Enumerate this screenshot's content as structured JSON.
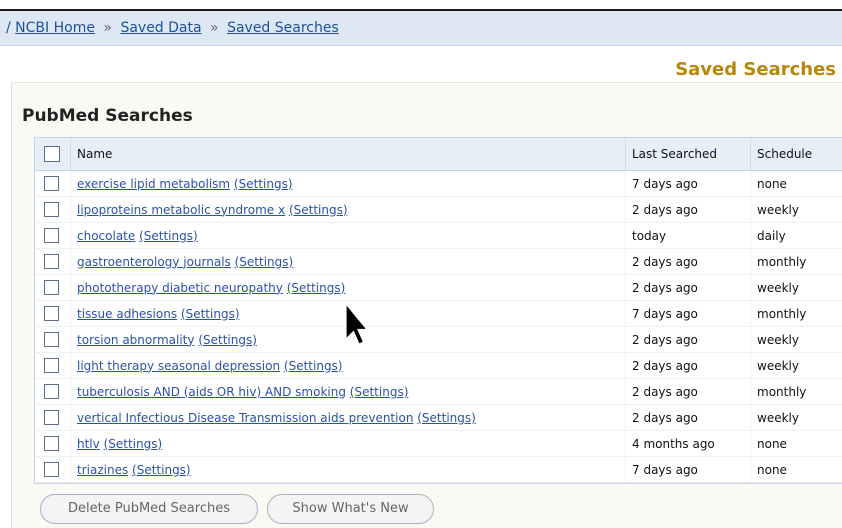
{
  "breadcrumb": {
    "lead": "/",
    "items": [
      "NCBI Home",
      "Saved Data",
      "Saved Searches"
    ],
    "separator": "»"
  },
  "page_heading": "Saved Searches",
  "section_title": "PubMed Searches",
  "table": {
    "columns": {
      "name": "Name",
      "last_searched": "Last Searched",
      "schedule": "Schedule"
    },
    "settings_label": "(Settings)",
    "rows": [
      {
        "name": "exercise lipid metabolism",
        "last": "7 days ago",
        "schedule": "none"
      },
      {
        "name": "lipoproteins metabolic syndrome x",
        "last": "2 days ago",
        "schedule": "weekly"
      },
      {
        "name": "chocolate",
        "last": "today",
        "schedule": "daily"
      },
      {
        "name": "gastroenterology journals",
        "last": "2 days ago",
        "schedule": "monthly"
      },
      {
        "name": "phototherapy diabetic neuropathy",
        "last": "2 days ago",
        "schedule": "weekly"
      },
      {
        "name": "tissue adhesions",
        "last": "7 days ago",
        "schedule": "monthly"
      },
      {
        "name": "torsion abnormality",
        "last": "2 days ago",
        "schedule": "weekly"
      },
      {
        "name": "light therapy seasonal depression",
        "last": "2 days ago",
        "schedule": "weekly"
      },
      {
        "name": "tuberculosis AND (aids OR hiv) AND smoking",
        "last": "2 days ago",
        "schedule": "monthly"
      },
      {
        "name": "vertical Infectious Disease Transmission aids prevention",
        "last": "2 days ago",
        "schedule": "weekly"
      },
      {
        "name": "htlv",
        "last": "4 months ago",
        "schedule": "none"
      },
      {
        "name": "triazines",
        "last": "7 days ago",
        "schedule": "none"
      }
    ]
  },
  "buttons": {
    "delete": "Delete PubMed Searches",
    "show_new": "Show What's New"
  },
  "colors": {
    "link": "#2a52a8",
    "heading": "#b8860b",
    "breadcrumb_bg": "#dde8f4"
  },
  "icons": {
    "cursor": "mouse-pointer-icon"
  }
}
